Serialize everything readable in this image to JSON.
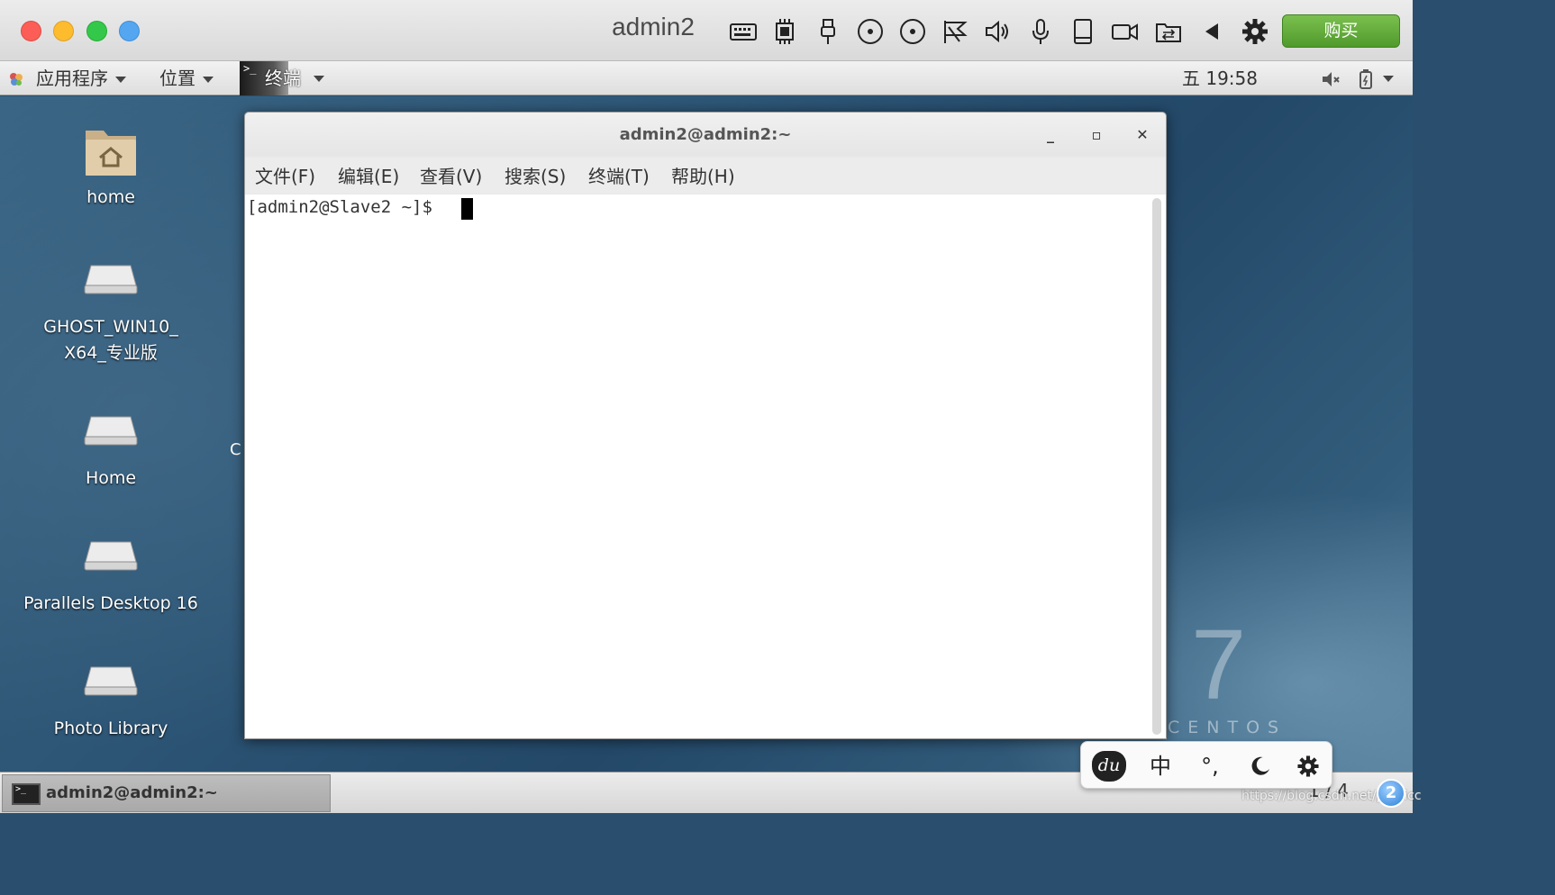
{
  "host_bar": {
    "vm_title": "admin2",
    "buy_label": "购买",
    "icons": [
      "keyboard-icon",
      "cpu-icon",
      "usb-icon",
      "cd-icon",
      "cd2-icon",
      "network-icon",
      "speaker-icon",
      "microphone-icon",
      "disk-icon",
      "camera-icon",
      "share-icon",
      "back-arrow-icon",
      "gear-icon"
    ]
  },
  "gnome_panel": {
    "applications_label": "应用程序",
    "places_label": "位置",
    "terminal_label": "终端",
    "clock": "五 19:58"
  },
  "desktop": {
    "items": [
      {
        "label": "home",
        "icon": "home-folder-icon"
      },
      {
        "label": "GHOST_WIN10_\nX64_专业版",
        "line1": "GHOST_WIN10_",
        "line2": "X64_专业版",
        "icon": "drive-icon"
      },
      {
        "label": "Home",
        "icon": "drive-icon"
      },
      {
        "label": "Parallels Desktop 16",
        "icon": "drive-icon"
      },
      {
        "label": "Photo Library",
        "icon": "drive-icon"
      }
    ],
    "stray_char": "C",
    "branding_number": "7",
    "branding_word": "CENTOS"
  },
  "terminal": {
    "title": "admin2@admin2:~",
    "menu": [
      "文件(F)",
      "编辑(E)",
      "查看(V)",
      "搜索(S)",
      "终端(T)",
      "帮助(H)"
    ],
    "prompt": "[admin2@Slave2 ~]$ "
  },
  "bottom_panel": {
    "task_label": "admin2@admin2:~",
    "workspace": "1 / 4",
    "help_badge": "2",
    "watermark": "https://blog.csdn.net/publicc"
  },
  "ime": {
    "du_label": "du",
    "mode_label": "中",
    "punct_label": "°,",
    "icons": [
      "du-bear-icon",
      "chinese-mode-icon",
      "punctuation-icon",
      "moon-icon",
      "gear-icon"
    ]
  }
}
